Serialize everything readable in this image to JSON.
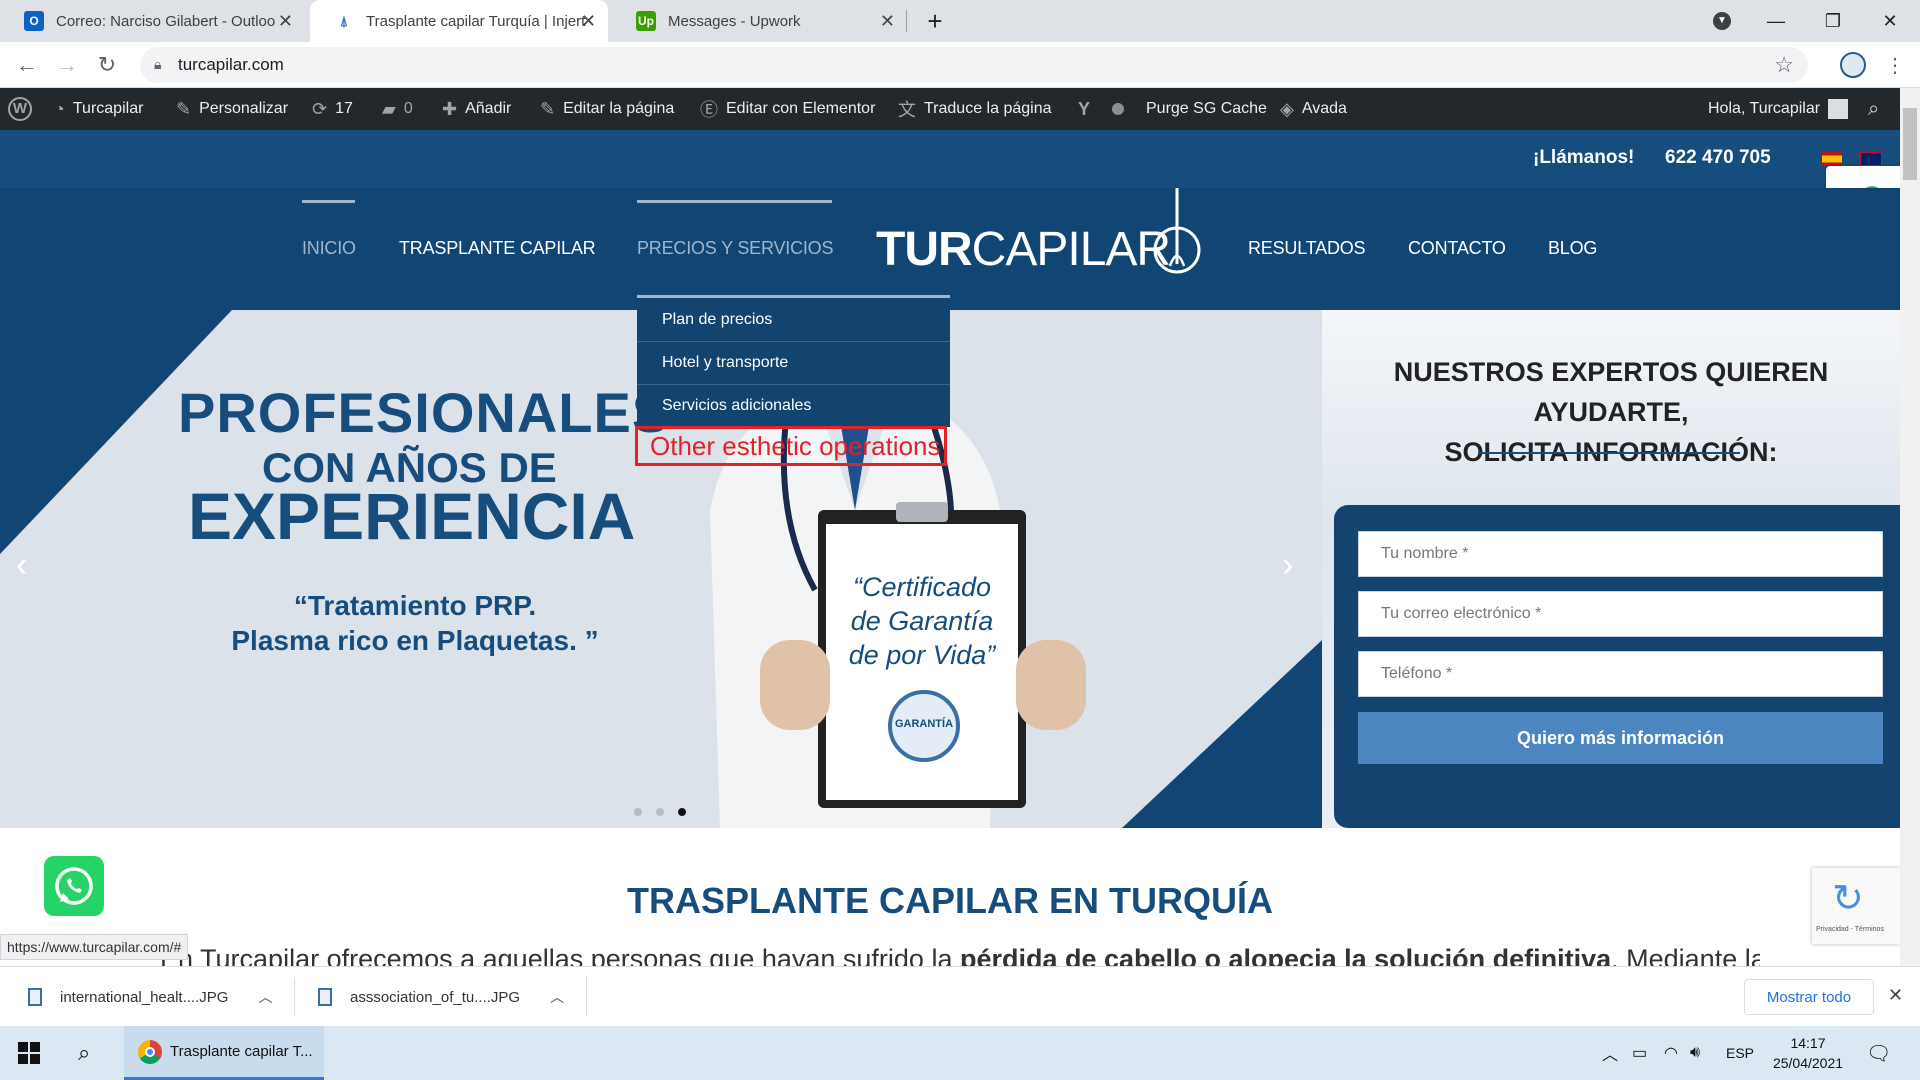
{
  "browser": {
    "tabs": [
      {
        "title": "Correo: Narciso Gilabert - Outloo",
        "favicon": "outlook-icon"
      },
      {
        "title": "Trasplante capilar Turquía | Injert",
        "favicon": "turcapilar-icon"
      },
      {
        "title": "Messages - Upwork",
        "favicon": "upwork-icon"
      }
    ],
    "new_tab": "+",
    "url": "turcapilar.com",
    "status_url": "https://www.turcapilar.com/#"
  },
  "adminbar": {
    "site": "Turcapilar",
    "customize": "Personalizar",
    "updates": "17",
    "comments": "0",
    "add": "Añadir",
    "edit_page": "Editar la página",
    "edit_elementor": "Editar con Elementor",
    "translate": "Traduce la página",
    "purge": "Purge SG Cache",
    "theme": "Avada",
    "greeting": "Hola, Turcapilar"
  },
  "topbar": {
    "call_label": "¡Llámanos!",
    "phone": "622 470 705"
  },
  "nav": {
    "items": [
      "INICIO",
      "TRASPLANTE CAPILAR",
      "PRECIOS Y SERVICIOS",
      "RESULTADOS",
      "CONTACTO",
      "BLOG"
    ],
    "logo_bold": "TUR",
    "logo_light": "CAPILAR",
    "dropdown": [
      "Plan de precios",
      "Hotel y transporte",
      "Servicios adicionales"
    ],
    "annotation": "Other esthetic operations"
  },
  "hero": {
    "line1": "PROFESIONALES",
    "line2": "CON AÑOS DE",
    "line3": "EXPERIENCIA",
    "quote1": "“Tratamiento PRP.",
    "quote2": "Plasma rico en Plaquetas. ”",
    "clipboard1": "“Certificado",
    "clipboard2": "de Garantía",
    "clipboard3": "de por Vida”",
    "seal": "GARANTÍA",
    "dots": 3,
    "active_dot": 3
  },
  "form": {
    "heading1": "NUESTROS EXPERTOS QUIEREN AYUDARTE,",
    "heading2": "SOLICITA INFORMACIÓN:",
    "name_placeholder": "Tu nombre *",
    "email_placeholder": "Tu correo electrónico *",
    "phone_placeholder": "Teléfono *",
    "submit": "Quiero más información"
  },
  "recaptcha": {
    "text": "Privacidad - Términos"
  },
  "content": {
    "title": "TRASPLANTE CAPILAR EN TURQUÍA",
    "intro_start": "En Turcapilar ofrecemos a aquellas personas que hayan sufrido la ",
    "intro_bold": "pérdida de cabello o alopecia la solución definitiva",
    "intro_end": ". Mediante las"
  },
  "downloads": {
    "files": [
      "international_healt....JPG",
      "asssociation_of_tu....JPG"
    ],
    "show_all": "Mostrar todo"
  },
  "taskbar": {
    "app_label": "Trasplante capilar T...",
    "lang": "ESP",
    "time": "14:17",
    "date": "25/04/2021"
  },
  "colors": {
    "brand_dark": "#104574",
    "brand_mid": "#174d7c",
    "button": "#4c86c0",
    "annotation": "#e0222a"
  }
}
